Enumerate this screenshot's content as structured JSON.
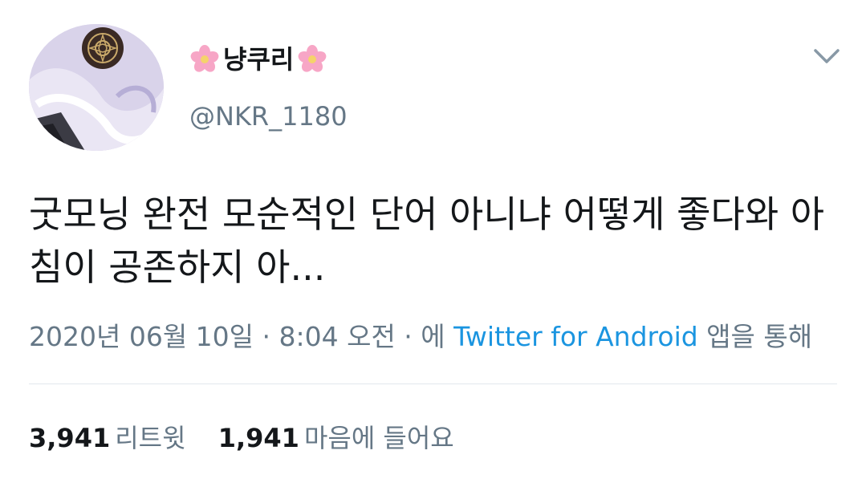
{
  "user": {
    "display_name": "냥쿠리",
    "handle": "@NKR_1180",
    "name_decoration_icon": "cherry-blossom-icon",
    "avatar_colors": {
      "background": "#d6d0e8",
      "emblem": "#3a2a24",
      "emblem_gold": "#c9a96a"
    }
  },
  "menu": {
    "icon": "chevron-down-icon"
  },
  "tweet": {
    "text": "굿모닝 완전 모순적인 단어 아니냐 어떻게 좋다와 아침이 공존하지 아...",
    "meta_prefix": "2020년 06월 10일 · 8:04 오전 · 에 ",
    "source": "Twitter for Android",
    "meta_suffix": " 앱을 통해"
  },
  "stats": {
    "retweets_count": "3,941",
    "retweets_label": "리트윗",
    "likes_count": "1,941",
    "likes_label": "마음에 들어요"
  },
  "colors": {
    "text_primary": "#14171a",
    "text_secondary": "#657786",
    "link": "#1b95e0",
    "divider": "#e1e8ed"
  }
}
